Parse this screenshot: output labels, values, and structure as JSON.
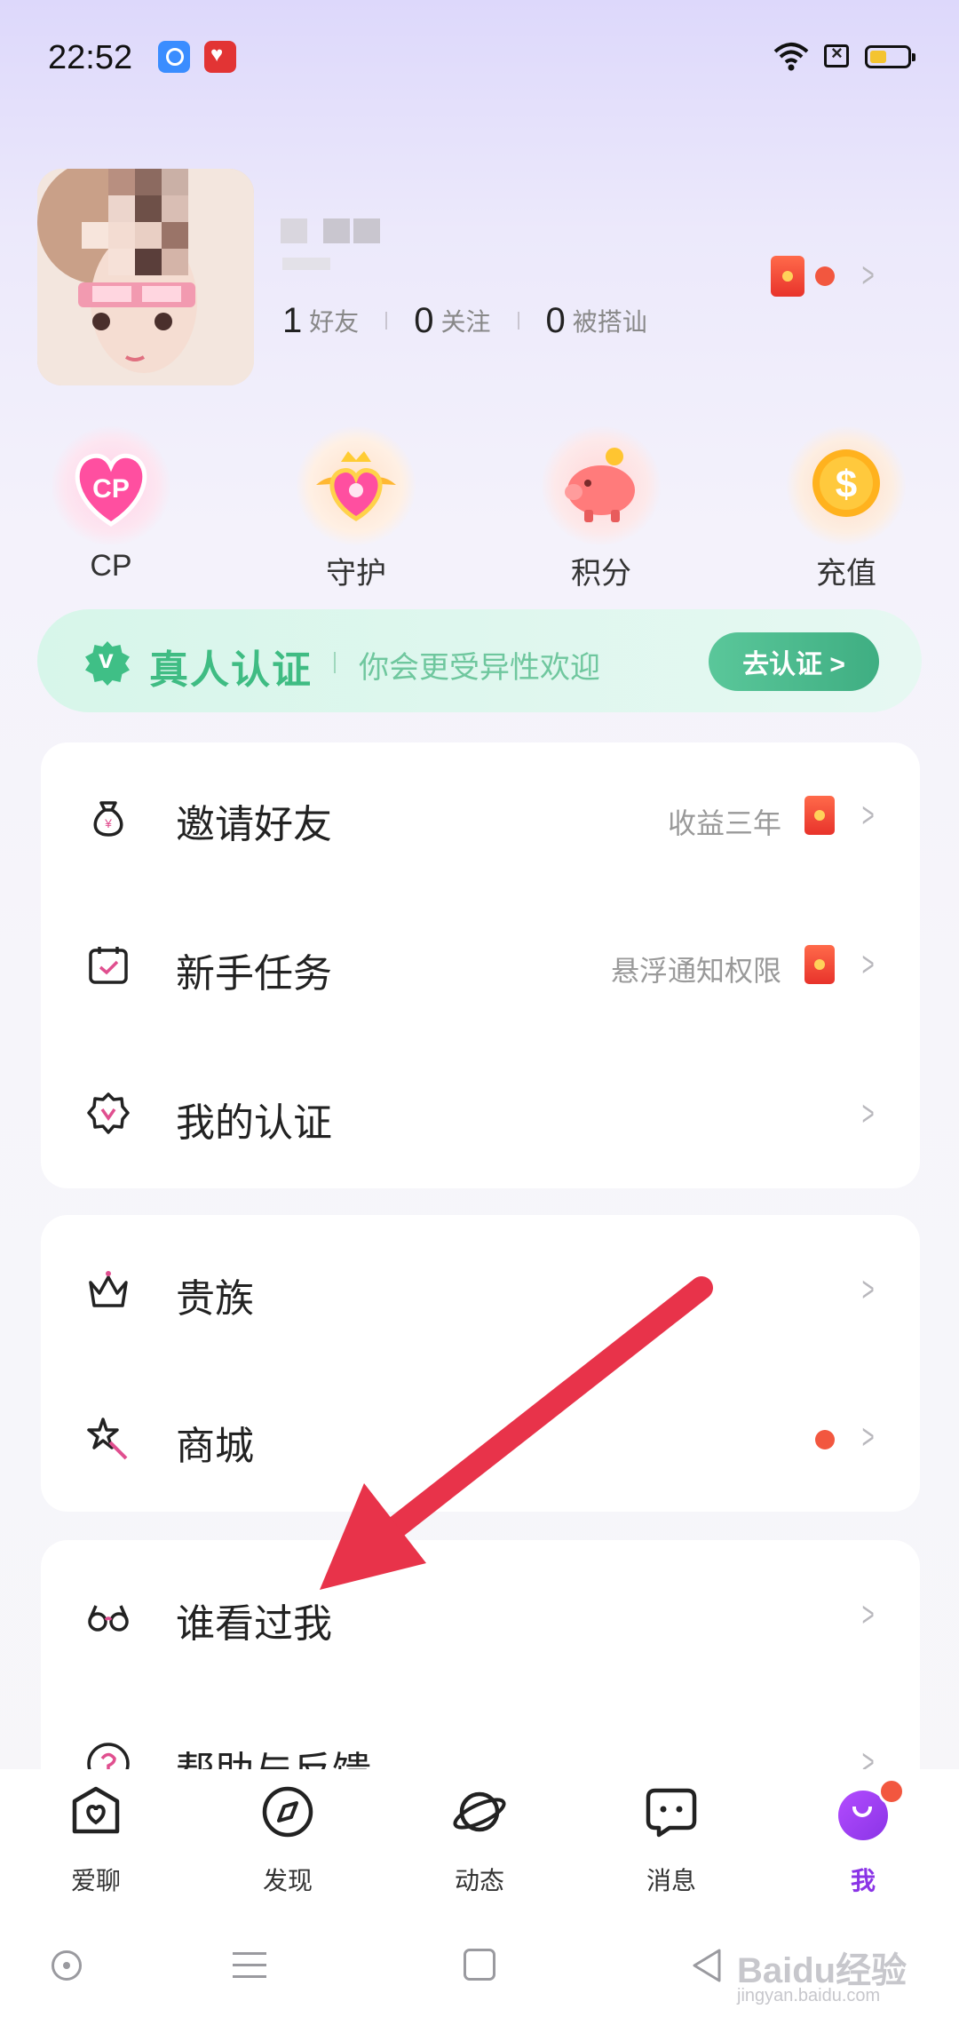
{
  "status_bar": {
    "time": "22:52",
    "icons": [
      "qq-notification-icon",
      "red-app-notification-icon",
      "wifi-icon",
      "sim-off-icon",
      "battery-icon"
    ],
    "battery_level": 0.45
  },
  "profile": {
    "stats": [
      {
        "num": "1",
        "label": "好友"
      },
      {
        "num": "0",
        "label": "关注"
      },
      {
        "num": "0",
        "label": "被搭讪"
      }
    ]
  },
  "quick_actions": [
    {
      "label": "CP",
      "icon": "cp-heart-icon"
    },
    {
      "label": "守护",
      "icon": "guard-crown-heart-icon"
    },
    {
      "label": "积分",
      "icon": "piggy-bank-icon"
    },
    {
      "label": "充值",
      "icon": "gold-coin-icon"
    }
  ],
  "verify_banner": {
    "title": "真人认证",
    "subtitle": "你会更受异性欢迎",
    "button": "去认证 >"
  },
  "menu_group_1": [
    {
      "label": "邀请好友",
      "hint": "收益三年",
      "icon": "money-bag-icon"
    },
    {
      "label": "新手任务",
      "hint": "悬浮通知权限",
      "icon": "calendar-check-icon"
    },
    {
      "label": "我的认证",
      "hint": "",
      "icon": "badge-icon"
    }
  ],
  "menu_group_2": [
    {
      "label": "贵族",
      "icon": "crown-icon"
    },
    {
      "label": "商城",
      "icon": "magic-wand-icon"
    }
  ],
  "menu_group_3": [
    {
      "label": "谁看过我",
      "icon": "glasses-icon"
    },
    {
      "label": "帮助与反馈",
      "icon": "help-icon"
    }
  ],
  "bottom_nav": [
    {
      "label": "爱聊",
      "icon": "home-heart-icon"
    },
    {
      "label": "发现",
      "icon": "compass-icon"
    },
    {
      "label": "动态",
      "icon": "planet-icon"
    },
    {
      "label": "消息",
      "icon": "chat-icon"
    },
    {
      "label": "我",
      "icon": "me-icon",
      "active": true
    }
  ],
  "watermark": {
    "text": "Baidu经验",
    "sub": "jingyan.baidu.com"
  },
  "colors": {
    "accent_green": "#3fbc83",
    "accent_purple": "#8a34e6",
    "red_dot": "#f2573f",
    "annotation_arrow": "#e8334a"
  }
}
